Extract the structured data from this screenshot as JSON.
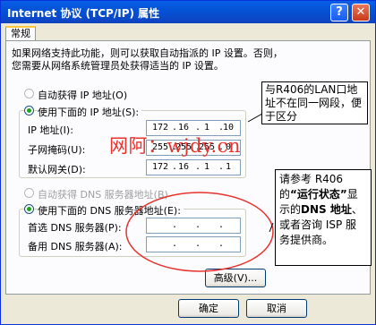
{
  "window": {
    "title": "Internet 协议 (TCP/IP) 属性",
    "help_glyph": "?",
    "close_glyph": "✕"
  },
  "tabs": [
    {
      "label": "常规",
      "selected": true
    }
  ],
  "intro": {
    "line1": "如果网络支持此功能，则可以获取自动指派的 IP 设置。否则，",
    "line2": "您需要从网络系统管理员处获得适当的 IP 设置。"
  },
  "ip_section": {
    "auto_label": "自动获得 IP 地址(O)",
    "manual_label": "使用下面的 IP 地址(S):",
    "selected": "manual",
    "fields": [
      {
        "label": "IP 地址(I):",
        "octets": [
          "172",
          "16",
          "1",
          "10"
        ]
      },
      {
        "label": "子网掩码(U):",
        "octets": [
          "255",
          "255",
          "255",
          "0"
        ]
      },
      {
        "label": "默认网关(D):",
        "octets": [
          "172",
          "16",
          "1",
          "1"
        ]
      }
    ]
  },
  "dns_section": {
    "auto_label": "自动获得 DNS 服务器地址(B)",
    "manual_label": "使用下面的 DNS 服务器地址(E):",
    "selected": "manual",
    "auto_disabled": true,
    "fields": [
      {
        "label": "首选 DNS 服务器(P):",
        "octets": [
          "",
          "",
          "",
          ""
        ]
      },
      {
        "label": "备用 DNS 服务器(A):",
        "octets": [
          "",
          "",
          "",
          ""
        ]
      }
    ]
  },
  "buttons": {
    "advanced": "高级(V)...",
    "ok": "确定",
    "cancel": "取消"
  },
  "annotations": {
    "note1": "与R406的LAN口地址不在同一网段，便于区分",
    "note2_a": "请参考 R406 的",
    "note2_b": "“运行状态”",
    "note2_c": "显示的",
    "note2_d": "DNS 地址",
    "note2_e": "、或者咨询 ISP 服务提供商。",
    "watermark": "网阿：wjdy.cn"
  },
  "colors": {
    "title_bar": "#0453d6",
    "annotation_red": "#e8322e",
    "radio_selected": "#21a121"
  }
}
